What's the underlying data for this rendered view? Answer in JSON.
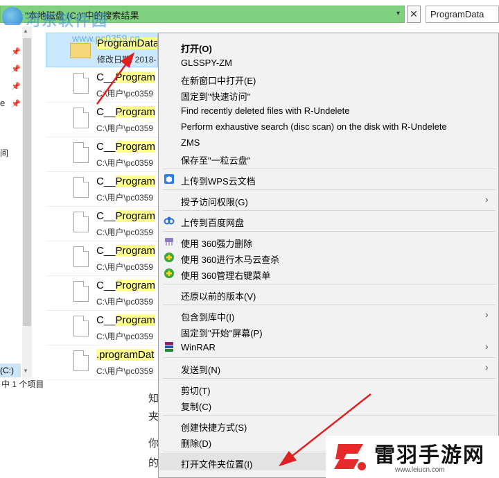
{
  "address_bar": {
    "path": "\"本地磁盘 (C:)\"中的搜索结果"
  },
  "search": {
    "value": "ProgramData"
  },
  "watermark": {
    "site_name": "河东软件园",
    "url": "www.pc0359.cn"
  },
  "nav": {
    "frag_e": "e",
    "frag_b": "间",
    "drive_label": "(C:)"
  },
  "status_bar": {
    "text": "中 1 个项目"
  },
  "results": [
    {
      "name_hl": "ProgramData",
      "name_rest": "",
      "path": "修改日期: 2018-",
      "type": "folder",
      "selected": true
    },
    {
      "name_pre": "C__",
      "name_hl": "Program",
      "path": "C:\\用户\\pc0359"
    },
    {
      "name_pre": "C__",
      "name_hl": "Program",
      "path": "C:\\用户\\pc0359"
    },
    {
      "name_pre": "C__",
      "name_hl": "Program",
      "path": "C:\\用户\\pc0359"
    },
    {
      "name_pre": "C__",
      "name_hl": "Program",
      "path": "C:\\用户\\pc0359"
    },
    {
      "name_pre": "C__",
      "name_hl": "Program",
      "path": "C:\\用户\\pc0359"
    },
    {
      "name_pre": "C__",
      "name_hl": "Program",
      "path": "C:\\用户\\pc0359"
    },
    {
      "name_pre": "C__",
      "name_hl": "Program",
      "path": "C:\\用户\\pc0359"
    },
    {
      "name_pre": "C__",
      "name_hl": "Program",
      "path": "C:\\用户\\pc0359"
    },
    {
      "name_pre": "",
      "name_hl": ".programDat",
      "path": "C:\\用户\\pc0359"
    }
  ],
  "background_text": {
    "line1": "知",
    "line2": "夹",
    "line3": "你",
    "line4": "的"
  },
  "context_menu": {
    "open": "打开(O)",
    "glsspy": "GLSSPY-ZM",
    "open_new_window": "在新窗口中打开(E)",
    "pin_quick_access": "固定到\"快速访问\"",
    "r_undelete_find": "Find recently deleted files with R-Undelete",
    "r_undelete_scan": "Perform exhaustive search (disc scan) on the disk with R-Undelete",
    "zms": "ZMS",
    "save_to_cloud": "保存至\"一粒云盘\"",
    "upload_wps": "上传到WPS云文档",
    "grant_access": "授予访问权限(G)",
    "upload_baidu": "上传到百度网盘",
    "force_delete_360": "使用 360强力删除",
    "trojan_scan_360": "使用 360进行木马云查杀",
    "menu_manage_360": "使用 360管理右键菜单",
    "restore_versions": "还原以前的版本(V)",
    "include_library": "包含到库中(I)",
    "pin_start": "固定到\"开始\"屏幕(P)",
    "winrar": "WinRAR",
    "send_to": "发送到(N)",
    "cut": "剪切(T)",
    "copy": "复制(C)",
    "create_shortcut": "创建快捷方式(S)",
    "delete": "删除(D)",
    "open_file_location": "打开文件夹位置(I)"
  },
  "brand": {
    "name": "雷羽手游网",
    "url": "www.leiucn.com"
  },
  "colors": {
    "address_bar": "#7fd17f",
    "highlight": "#ffff8d",
    "selection": "#cce8ff",
    "arrow": "#e02020"
  }
}
